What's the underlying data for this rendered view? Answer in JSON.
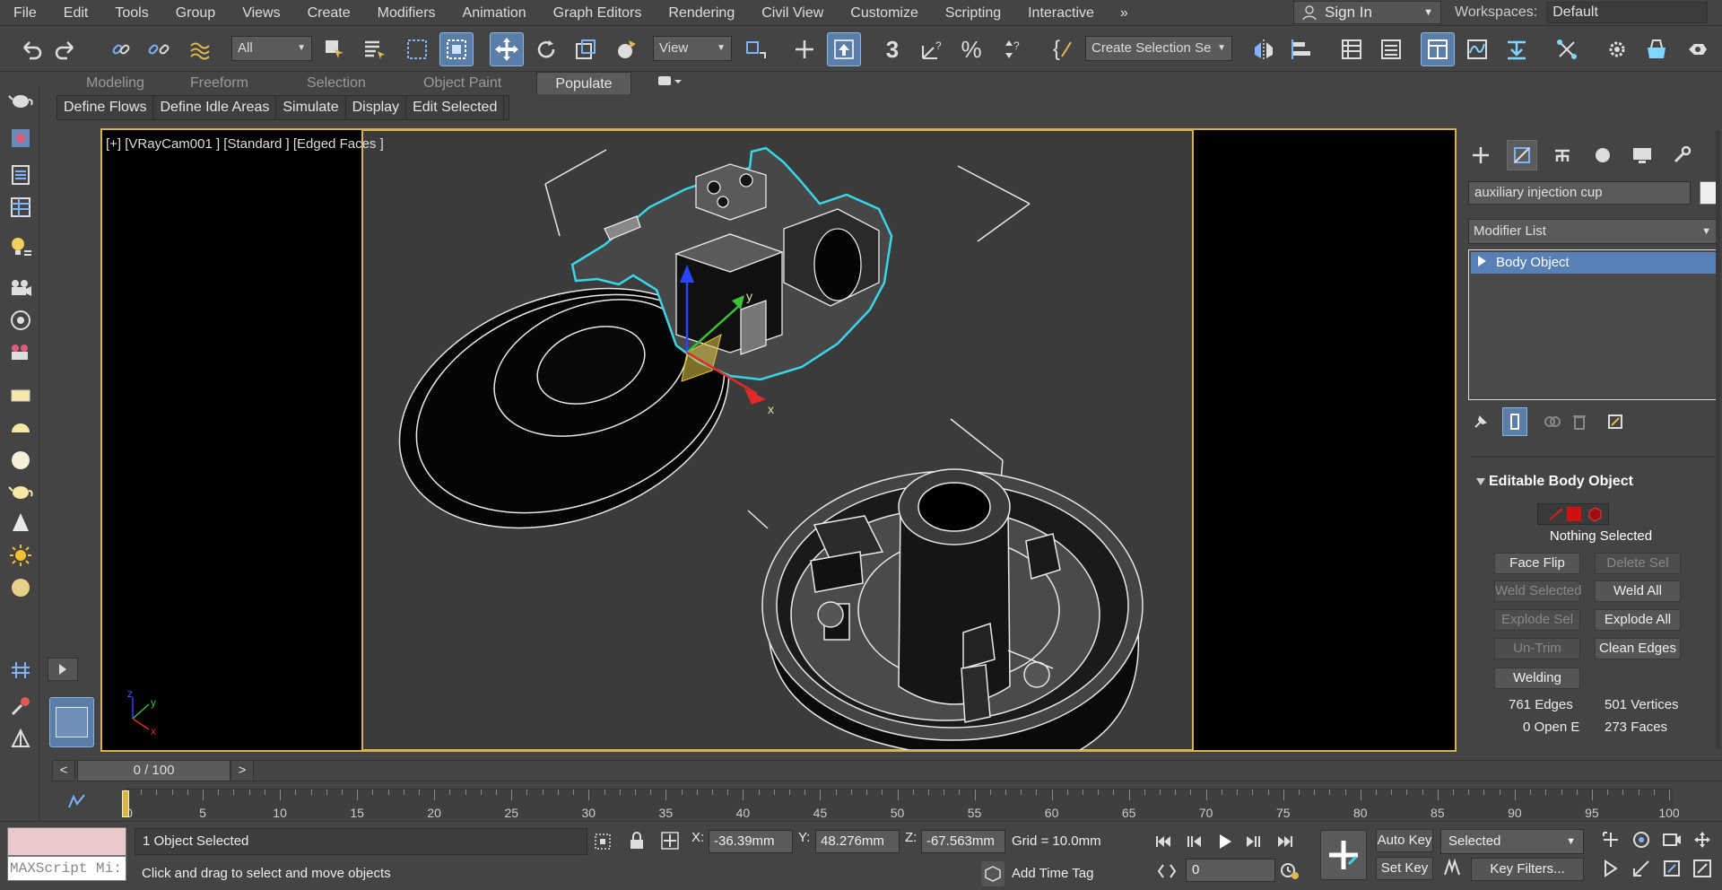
{
  "menu": [
    "File",
    "Edit",
    "Tools",
    "Group",
    "Views",
    "Create",
    "Modifiers",
    "Animation",
    "Graph Editors",
    "Rendering",
    "Civil View",
    "Customize",
    "Scripting",
    "Interactive"
  ],
  "menu_overflow": "»",
  "signin": {
    "label": "Sign In"
  },
  "workspaces": {
    "label": "Workspaces:",
    "value": "Default"
  },
  "toolbar": {
    "filter_dropdown": "All",
    "view_dropdown": "View",
    "selection_set": "Create Selection Se",
    "angle_snap_label": "3"
  },
  "ribbon": {
    "tabs": [
      "Modeling",
      "Freeform",
      "Selection",
      "Object Paint",
      "Populate"
    ],
    "active_tab": "Populate",
    "sub_buttons": [
      "Define Flows",
      "Define Idle Areas",
      "Simulate",
      "Display",
      "Edit Selected"
    ]
  },
  "viewport": {
    "label": "[+] [VRayCam001 ] [Standard ] [Edged Faces ]",
    "gizmo_x": "x",
    "gizmo_y": "y",
    "axis_x": "x",
    "axis_y": "y",
    "axis_z": "z"
  },
  "command_panel": {
    "object_name": "auxiliary injection cup",
    "object_color": "#f0f0f0",
    "modifier_list": "Modifier List",
    "stack_item": "Body Object",
    "rollout_title": "Editable Body Object",
    "selection_status": "Nothing Selected",
    "buttons": [
      {
        "label": "Face Flip",
        "enabled": true
      },
      {
        "label": "Delete Sel",
        "enabled": false
      },
      {
        "label": "Weld Selected",
        "enabled": false
      },
      {
        "label": "Weld All",
        "enabled": true
      },
      {
        "label": "Explode Sel",
        "enabled": false
      },
      {
        "label": "Explode All",
        "enabled": true
      },
      {
        "label": "Un-Trim",
        "enabled": false
      },
      {
        "label": "Clean Edges",
        "enabled": true
      },
      {
        "label": "Welding",
        "enabled": true
      }
    ],
    "stats": {
      "edges": "761 Edges",
      "vertices": "501 Vertices",
      "open_edges": "0 Open E",
      "faces": "273 Faces"
    }
  },
  "time_slider": {
    "frame": "0 / 100",
    "prev": "<",
    "next": ">"
  },
  "trackbar": {
    "ticks": [
      "0",
      "5",
      "10",
      "15",
      "20",
      "25",
      "30",
      "35",
      "40",
      "45",
      "50",
      "55",
      "60",
      "65",
      "70",
      "75",
      "80",
      "85",
      "90",
      "95",
      "100"
    ]
  },
  "status": {
    "maxscript": "MAXScript Mi:",
    "objects_selected": "1 Object Selected",
    "prompt": "Click and drag to select and move objects",
    "x_label": "X:",
    "x_value": "-36.39mm",
    "y_label": "Y:",
    "y_value": "48.276mm",
    "z_label": "Z:",
    "z_value": "-67.563mm",
    "grid": "Grid = 10.0mm",
    "add_time_tag": "Add Time Tag",
    "frame_value": "0",
    "auto_key": "Auto Key",
    "set_key": "Set Key",
    "key_filter_set": "Selected",
    "key_filters": "Key Filters..."
  },
  "colors": {
    "accent": "#5a7ea8",
    "selection_outline": "#3ad6e6",
    "viewport_border": "#d8b450",
    "stack_highlight": "#5680b6"
  }
}
